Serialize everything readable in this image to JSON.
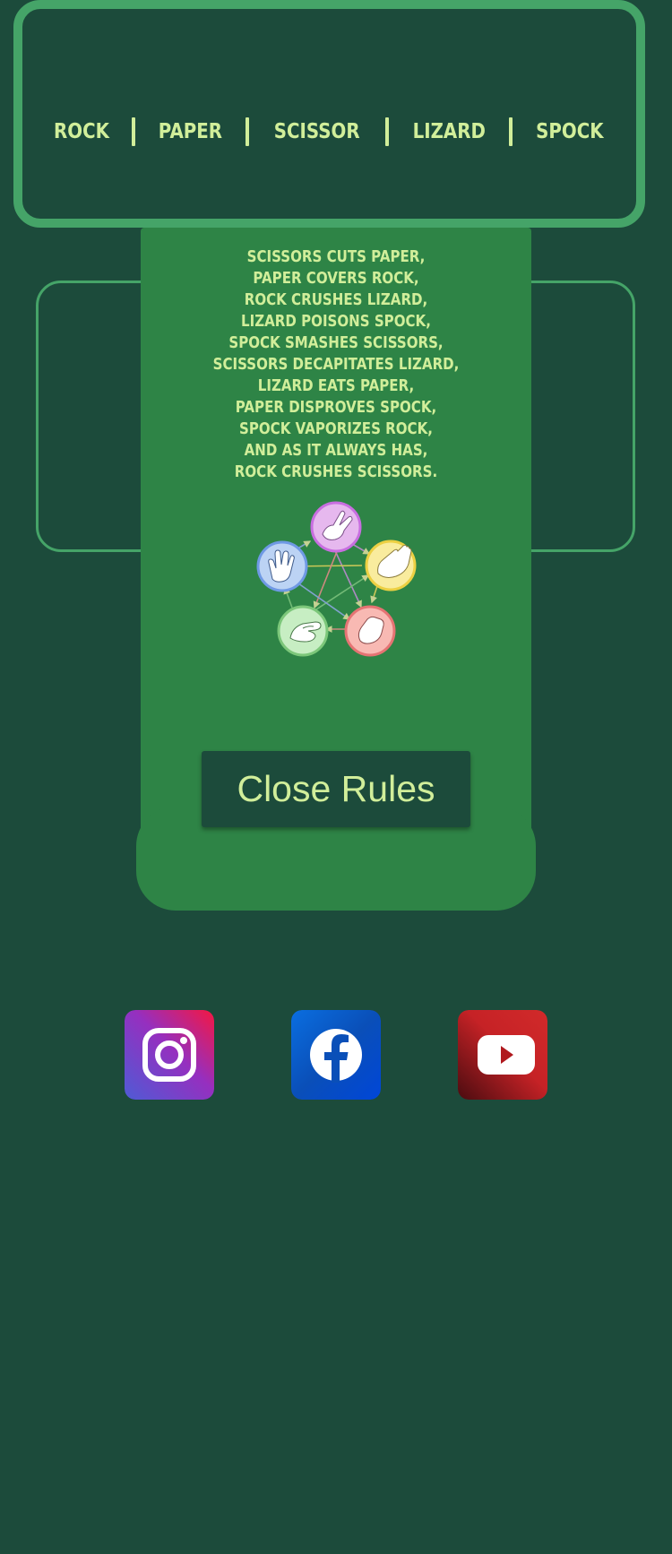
{
  "header": {
    "words": [
      "ROCK",
      "PAPER",
      "SCISSOR",
      "LIZARD",
      "SPOCK"
    ]
  },
  "rules_modal": {
    "lines": [
      "SCISSORS CUTS PAPER,",
      "PAPER COVERS ROCK,",
      "ROCK CRUSHES LIZARD,",
      "LIZARD POISONS SPOCK,",
      "SPOCK SMASHES SCISSORS,",
      "SCISSORS DECAPITATES LIZARD,",
      "LIZARD EATS PAPER,",
      "PAPER DISPROVES SPOCK,",
      "SPOCK VAPORIZES ROCK,",
      "AND AS IT ALWAYS HAS,",
      "ROCK CRUSHES SCISSORS."
    ],
    "diagram_icons": [
      "scissors-hand-icon",
      "paper-hand-icon",
      "rock-hand-icon",
      "lizard-hand-icon",
      "spock-hand-icon"
    ],
    "close_label": "Close Rules"
  },
  "social": [
    {
      "name": "instagram",
      "icon": "instagram-icon"
    },
    {
      "name": "facebook",
      "icon": "facebook-icon"
    },
    {
      "name": "youtube",
      "icon": "youtube-icon"
    }
  ],
  "colors": {
    "background": "#1c4b3b",
    "border": "#45a468",
    "modal": "#2e8446",
    "text": "#d1ee9a"
  }
}
